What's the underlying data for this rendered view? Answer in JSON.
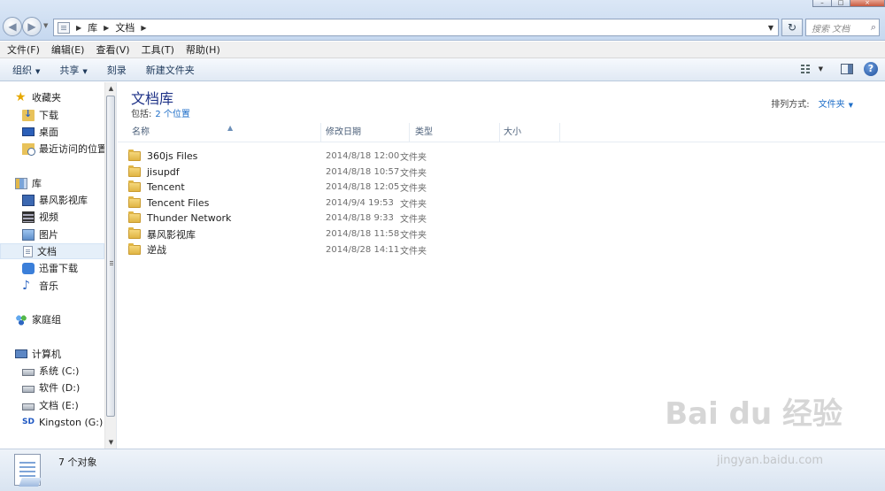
{
  "window": {
    "minimize_glyph": "–",
    "maximize_glyph": "□",
    "close_glyph": "×"
  },
  "address": {
    "back_glyph": "◀",
    "forward_glyph": "▶",
    "crumbs": [
      "库",
      "文档"
    ],
    "separator": "▶",
    "dropdown_glyph": "▼",
    "refresh_glyph": "↻",
    "search_placeholder": "搜索 文档",
    "search_glyph": "⌕"
  },
  "menu": [
    "文件(F)",
    "编辑(E)",
    "查看(V)",
    "工具(T)",
    "帮助(H)"
  ],
  "commands": {
    "organize": "组织",
    "share": "共享",
    "burn": "刻录",
    "new_folder": "新建文件夹",
    "dropdown_glyph": "▼",
    "help_glyph": "?"
  },
  "nav": {
    "favorites": "收藏夹",
    "downloads": "下载",
    "desktop": "桌面",
    "recent": "最近访问的位置",
    "libraries": "库",
    "baofeng": "暴风影视库",
    "videos": "视频",
    "pictures": "图片",
    "documents": "文档",
    "thunder": "迅雷下载",
    "music": "音乐",
    "homegroup": "家庭组",
    "computer": "计算机",
    "drive_c": "系统 (C:)",
    "drive_d": "软件 (D:)",
    "drive_e": "文档 (E:)",
    "drive_g": "Kingston (G:)",
    "sd_label": "SD",
    "star_glyph": "★",
    "music_glyph": "♪",
    "scroll_up": "▲",
    "scroll_down": "▼"
  },
  "library": {
    "title": "文档库",
    "includes_label": "包括:",
    "includes_link": "2 个位置",
    "arrange_label": "排列方式:",
    "arrange_value": "文件夹",
    "arrange_glyph": "▼"
  },
  "columns": {
    "name": "名称",
    "date": "修改日期",
    "type": "类型",
    "size": "大小",
    "sort_glyph": "▲"
  },
  "files": [
    {
      "name": "360js Files",
      "date": "2014/8/18 12:00",
      "type": "文件夹",
      "size": ""
    },
    {
      "name": "jisupdf",
      "date": "2014/8/18 10:57",
      "type": "文件夹",
      "size": ""
    },
    {
      "name": "Tencent",
      "date": "2014/8/18 12:05",
      "type": "文件夹",
      "size": ""
    },
    {
      "name": "Tencent Files",
      "date": "2014/9/4 19:53",
      "type": "文件夹",
      "size": ""
    },
    {
      "name": "Thunder Network",
      "date": "2014/8/18 9:33",
      "type": "文件夹",
      "size": ""
    },
    {
      "name": "暴风影视库",
      "date": "2014/8/18 11:58",
      "type": "文件夹",
      "size": ""
    },
    {
      "name": "逆战",
      "date": "2014/8/28 14:11",
      "type": "文件夹",
      "size": ""
    }
  ],
  "status": {
    "count_text": "7 个对象"
  },
  "watermark": {
    "logo": "Bai du 经验",
    "url": "jingyan.baidu.com"
  },
  "colors": {
    "title_blue": "#1e3287",
    "link_blue": "#1e6ec8",
    "folder_yellow": "#e0b544"
  }
}
